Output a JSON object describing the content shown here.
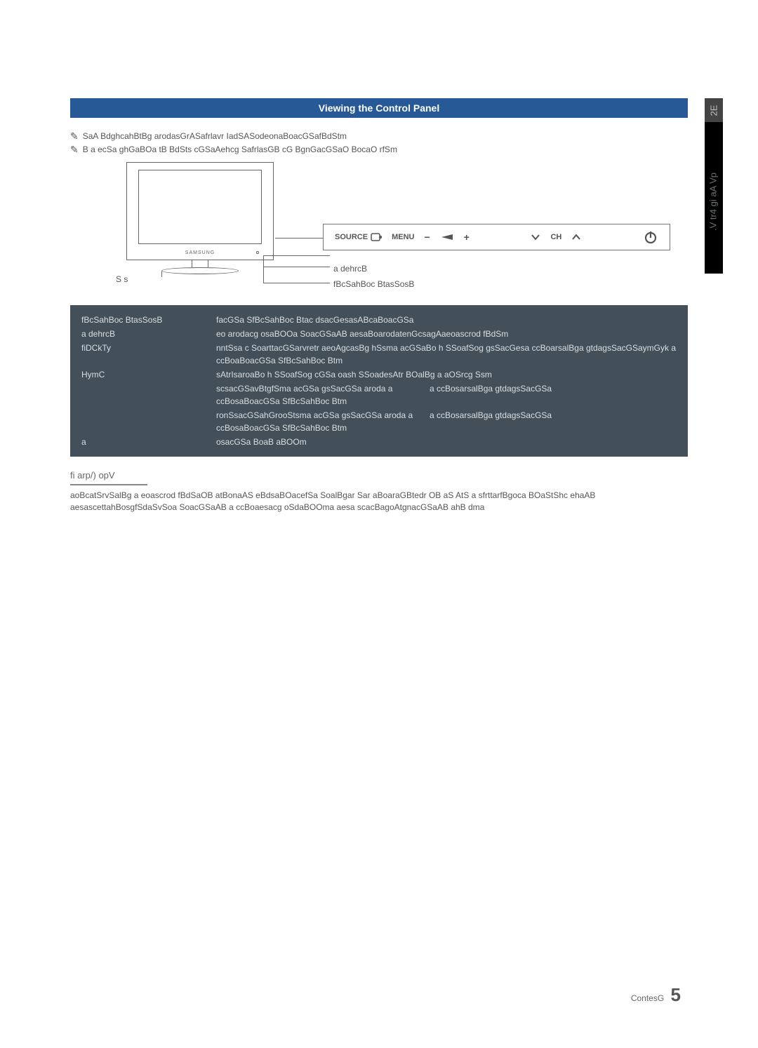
{
  "sideTab": {
    "num": "2E",
    "text": ".V tr4   gi aA Vp"
  },
  "header": {
    "title": "Viewing the Control Panel"
  },
  "notes": {
    "line1": "SaA BdghcahBtBg arodasGrASafrlavr IadSASodeonaBoacGSafBdStm",
    "line2": "B a ecSa  ghGaBOa tB  BdSts cGSaAehcg SafrlasGB cG BgnGacGSaO BocaO rfSm"
  },
  "tv": {
    "brand": "SAMSUNG"
  },
  "buttonStrip": {
    "source": "SOURCE",
    "menu": "MENU",
    "dash": "−",
    "plus": "+",
    "ch": "CH"
  },
  "labels": {
    "left": "S  s",
    "right1": "   a dehrcB",
    "right2": "fBcSahBoc BtasSosB"
  },
  "table": {
    "r1": {
      "k": "fBcSahBoc BtasSosB",
      "v": "facGSa SfBcSahBoc Btac dsacGesasABcaBoacGSa "
    },
    "r2": {
      "k": "   a dehrcB",
      "v": "eo arodacg osaBOOa SoacGSaAB  aesaBoarodatenGcsagAaeoascrod fBdSm"
    },
    "r3": {
      "k": "fiDCkTy",
      "v": "nntSsa c SoarttacGSarvretr aeoAgcasBg hSsma acGSaBo h SSoafSog gsSacGesa ccBoarsalBga gtdagsSacGSaymGyk   a ccBoaBoacGSa SfBcSahBoc Btm"
    },
    "r4": {
      "k": "HymC",
      "v": "sAtrIsaroaBo h SSoafSog cGSa  oash SSoadesAtr BOalBg a aOSrcg Ssm"
    },
    "r5a": {
      "left": "  scsacGSavBtgfSma acGSa gsSacGSa    aroda   a ccBosaBoacGSa SfBcSahBoc Btm",
      "right": "a ccBosarsalBga gtdagsSacGSa"
    },
    "r5b": {
      "left": "ronSsacGSahGrooStsma acGSa gsSacGSa    aroda   a ccBosaBoacGSa SfBcSahBoc Btm",
      "right": "a ccBosarsalBga gtdagsSacGSa"
    },
    "r6": {
      "k": "a   ",
      "v": "  osacGSa BoaB aBOOm"
    }
  },
  "standby": {
    "heading": "fi arp/)    opV",
    "body": "aoBcatSrvSalBg a eoascrod fBdSaOB atBonaAS eBdsaBOacefSa SoalBgar Sar aBoaraGBtedr OB aS AtS a sfrttarfBgoca BOaStShc ehaAB  aesascettahBosgfSdaSvSoa SoacGSaAB  a ccBoaesacg oSdaBOOma aesa scacBagoAtgnacGSaAB  ahB dma"
  },
  "footer": {
    "label": "ContesG",
    "page": "5"
  }
}
